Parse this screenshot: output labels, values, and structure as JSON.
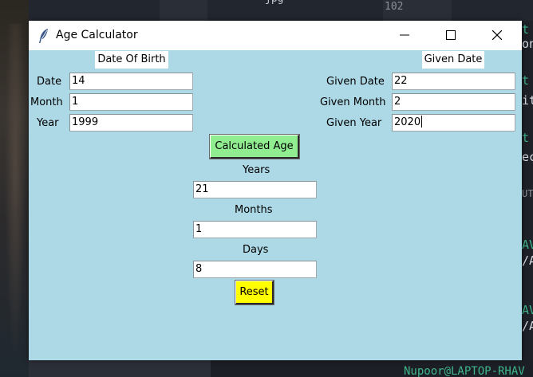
{
  "background": {
    "editor_filename": "jpg",
    "line_number": "102",
    "right_edge_fragments": [
      "t",
      "on",
      "t",
      "it",
      "t",
      "ec",
      "UT",
      "AV",
      "/A",
      "AV",
      "/A"
    ],
    "terminal_prompt": "Nupoor@LAPTOP-RHAV"
  },
  "window": {
    "title": "Age Calculator",
    "icon": "feather-icon",
    "controls": {
      "minimize": "minimize-icon",
      "maximize": "maximize-icon",
      "close": "close-icon"
    }
  },
  "dob": {
    "header": "Date Of Birth",
    "date_label": "Date",
    "date_value": "14",
    "month_label": "Month",
    "month_value": "1",
    "year_label": "Year",
    "year_value": "1999"
  },
  "given": {
    "header": "Given Date",
    "date_label": "Given Date",
    "date_value": "22",
    "month_label": "Given Month",
    "month_value": "2",
    "year_label": "Given Year",
    "year_value": "2020"
  },
  "actions": {
    "calculate_label": "Calculated Age",
    "reset_label": "Reset"
  },
  "result": {
    "years_label": "Years",
    "years_value": "21",
    "months_label": "Months",
    "months_value": "1",
    "days_label": "Days",
    "days_value": "8"
  },
  "colors": {
    "window_bg": "#add8e6",
    "calculate_button": "#90ee90",
    "reset_button": "#ffff00"
  }
}
